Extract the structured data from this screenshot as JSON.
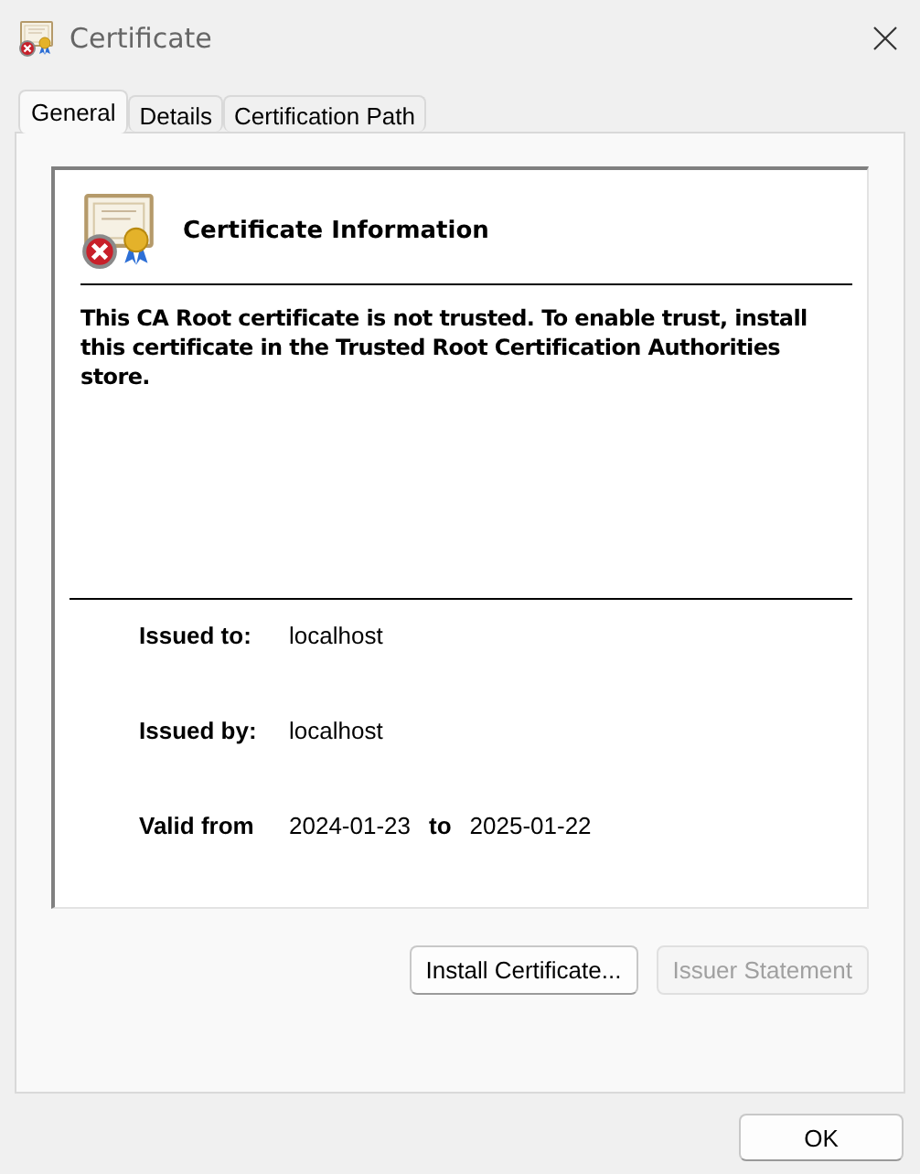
{
  "window": {
    "title": "Certificate"
  },
  "tabs": [
    {
      "label": "General",
      "selected": true
    },
    {
      "label": "Details",
      "selected": false
    },
    {
      "label": "Certification Path",
      "selected": false
    }
  ],
  "info": {
    "heading": "Certificate Information",
    "message": "This CA Root certificate is not trusted. To enable trust, install this certificate in the Trusted Root Certification Authorities store.",
    "rows": [
      {
        "kind": "pair",
        "label": "Issued to:",
        "value": "localhost"
      },
      {
        "kind": "pair",
        "label": "Issued by:",
        "value": "localhost"
      },
      {
        "kind": "range",
        "label": "Valid from",
        "from": "2024-01-23",
        "joiner": "to",
        "to": "2025-01-22"
      }
    ]
  },
  "panel_buttons": [
    {
      "label": "Install Certificate...",
      "disabled": false
    },
    {
      "label": "Issuer Statement",
      "disabled": true
    }
  ],
  "footer_buttons": [
    {
      "label": "OK",
      "disabled": false
    }
  ]
}
